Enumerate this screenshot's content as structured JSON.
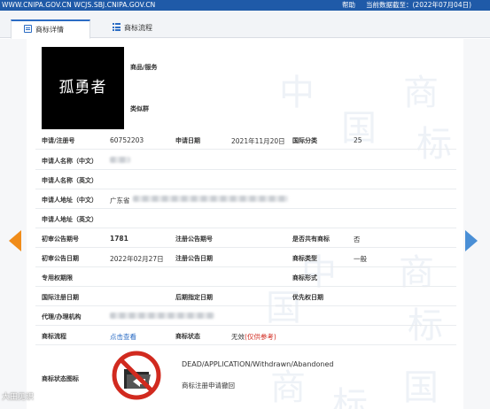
{
  "topbar": {
    "urls": "WWW.CNIPA.GOV.CN WCJS.SBJ.CNIPA.GOV.CN",
    "help": "帮助",
    "data_date": "当前数据截至：(2022年07月04日)"
  },
  "tabs": [
    {
      "label": "商标详情",
      "active": true
    },
    {
      "label": "商标流程",
      "active": false
    }
  ],
  "trademark": {
    "logo_text": "孤勇者",
    "goods_services_label": "商品/服务",
    "similar_group_label": "类似群"
  },
  "fields": {
    "reg_no_label": "申请/注册号",
    "reg_no": "60752203",
    "app_date_label": "申请日期",
    "app_date": "2021年11月20日",
    "intl_class_label": "国际分类",
    "intl_class": "25",
    "applicant_cn_label": "申请人名称（中文）",
    "applicant_en_label": "申请人名称（英文）",
    "address_cn_label": "申请人地址（中文）",
    "address_cn_prefix": "广东省",
    "address_en_label": "申请人地址（英文）",
    "prelim_pub_no_label": "初审公告期号",
    "prelim_pub_no": "1781",
    "reg_pub_no_label": "注册公告期号",
    "shared_label": "是否共有商标",
    "shared": "否",
    "prelim_pub_date_label": "初审公告日期",
    "prelim_pub_date": "2022年02月27日",
    "reg_pub_date_label": "注册公告日期",
    "tm_type_label": "商标类型",
    "tm_type": "一般",
    "exclusive_period_label": "专用权期限",
    "tm_form_label": "商标形式",
    "intl_reg_date_label": "国际注册日期",
    "later_designation_date_label": "后期指定日期",
    "priority_date_label": "优先权日期",
    "agent_label": "代理/办理机构",
    "process_label": "商标流程",
    "process_link": "点击查看",
    "status_label": "商标状态",
    "status_value": "无效",
    "status_note": "(仅供参考)",
    "status_icon_label": "商标状态图标",
    "status_en": "DEAD/APPLICATION/Withdrawn/Abandoned",
    "status_cn": "商标注册申请撤回"
  },
  "watermark": {
    "glyphs": [
      "中",
      "国",
      "商",
      "标"
    ],
    "bottom_text": "大田见识"
  },
  "colors": {
    "topbar": "#1f5aa8",
    "accent_blue": "#2b6cc4",
    "left_arrow": "#f08c1a",
    "right_arrow": "#4a8fd6",
    "status_red": "#d12a1f"
  }
}
